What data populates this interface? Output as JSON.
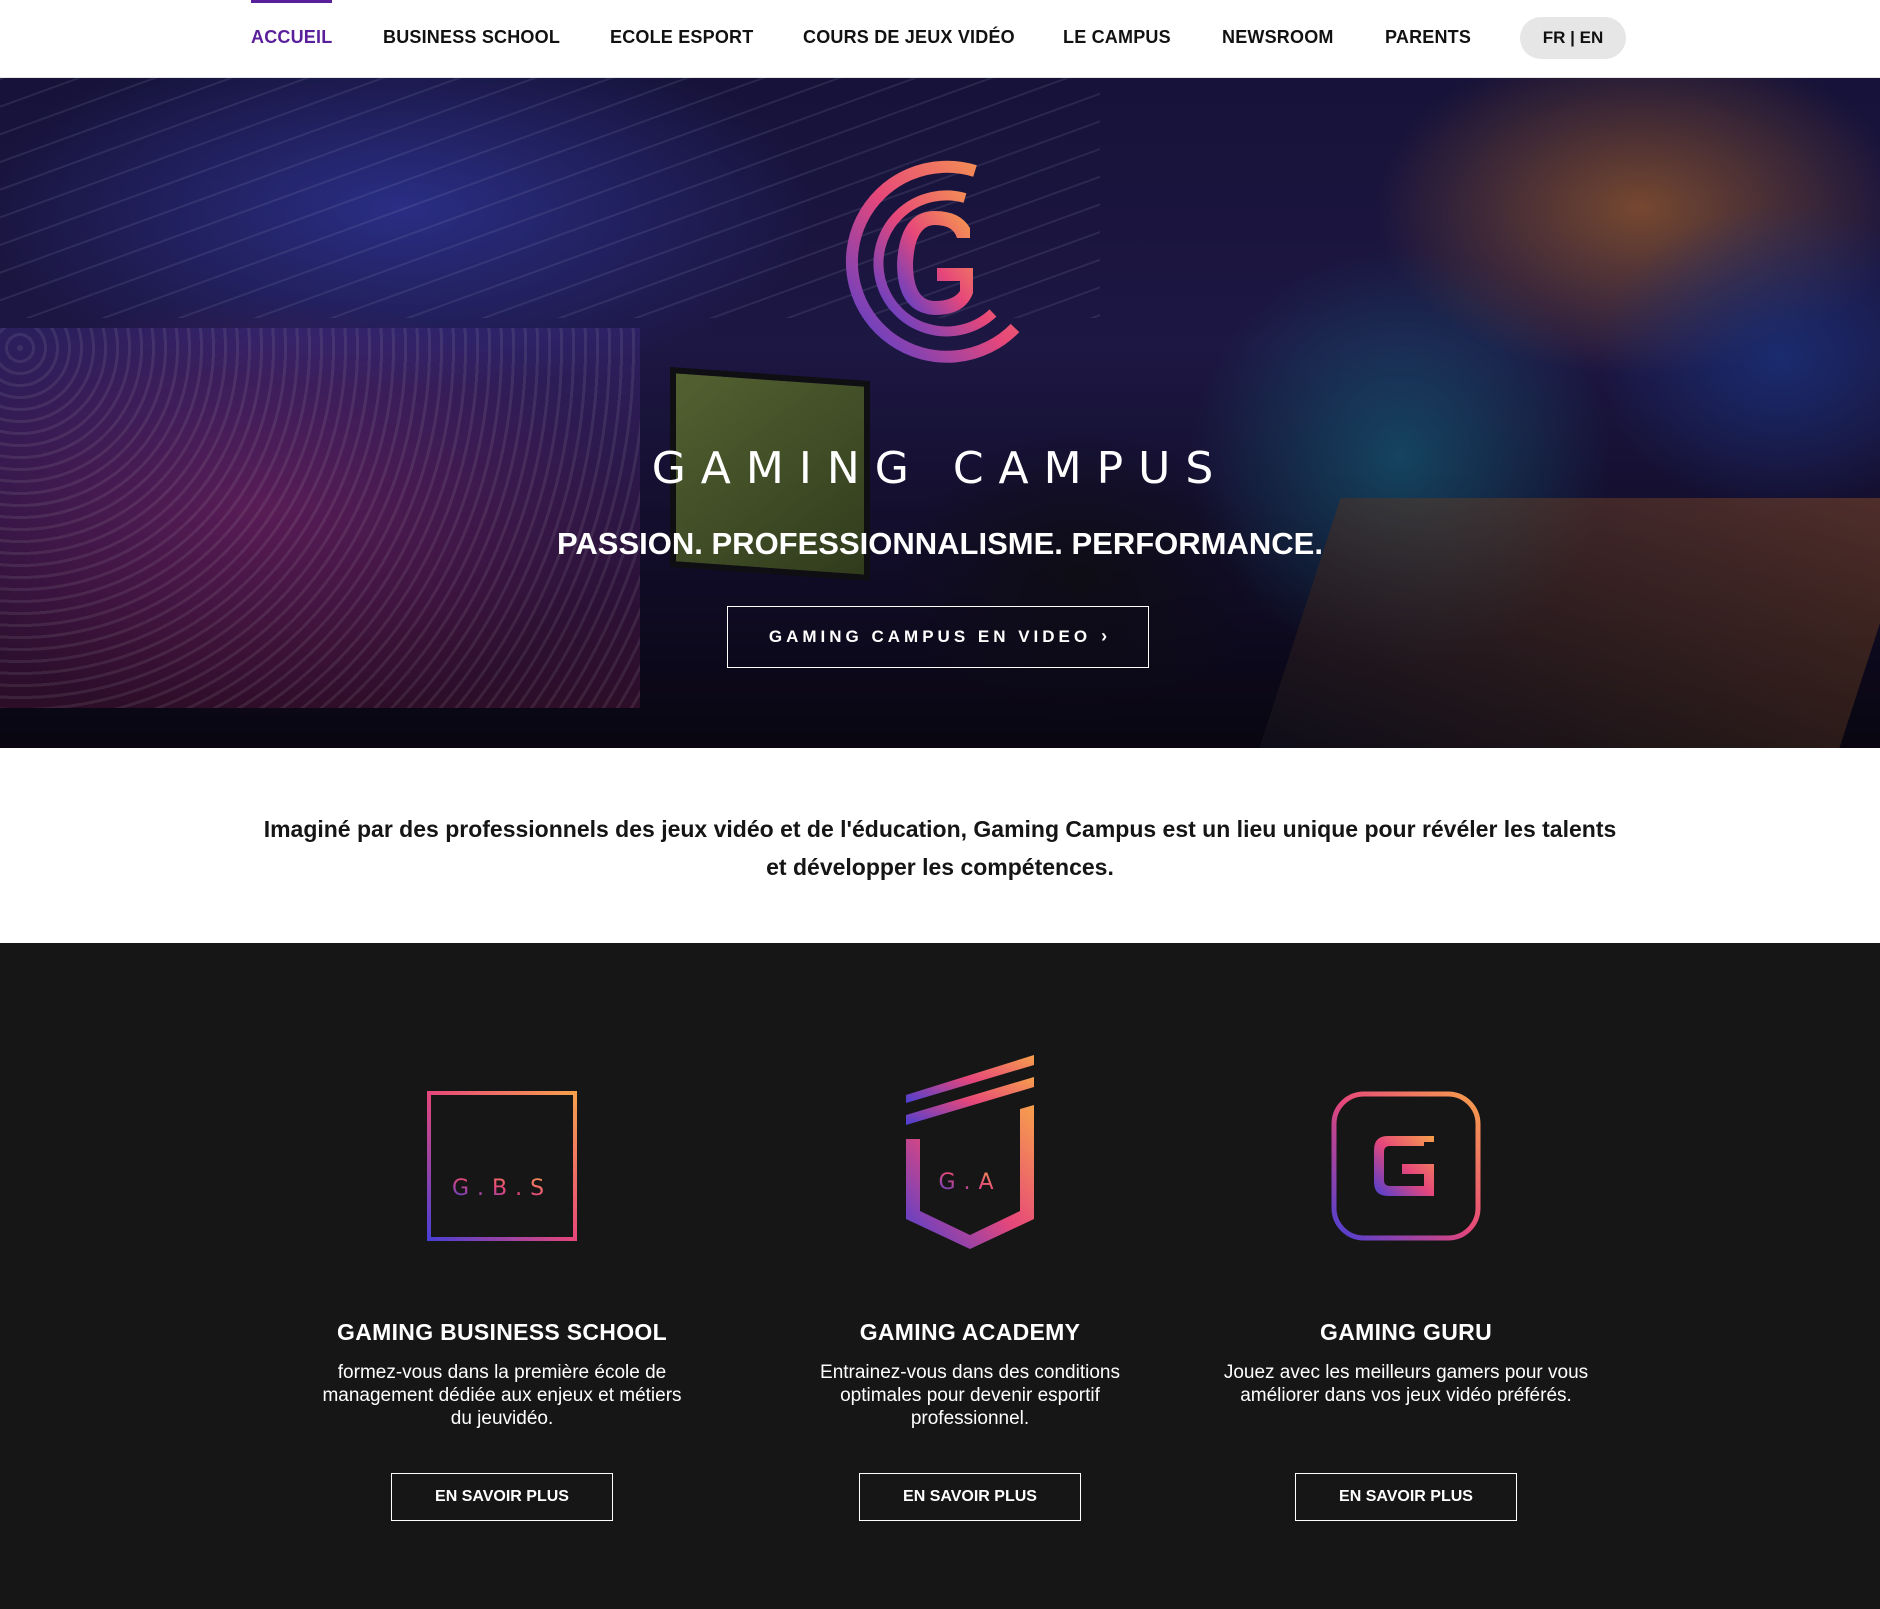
{
  "nav": {
    "items": [
      {
        "label": "ACCUEIL",
        "active": true
      },
      {
        "label": "BUSINESS SCHOOL",
        "active": false
      },
      {
        "label": "ECOLE ESPORT",
        "active": false
      },
      {
        "label": "COURS DE JEUX VIDÉO",
        "active": false
      },
      {
        "label": "LE CAMPUS",
        "active": false
      },
      {
        "label": "NEWSROOM",
        "active": false
      },
      {
        "label": "PARENTS",
        "active": false
      }
    ],
    "language": "FR | EN"
  },
  "hero": {
    "brand": "GAMING CAMPUS",
    "tagline": "PASSION. PROFESSIONNALISME. PERFORMANCE.",
    "video_button": "GAMING CAMPUS EN VIDEO",
    "video_button_icon": "chevron-right-icon"
  },
  "intro": {
    "text": "Imaginé par des professionnels des jeux vidéo et de l'éducation, Gaming Campus est un lieu unique pour révéler les talents et développer les compétences."
  },
  "programs": [
    {
      "logo_text": "G.B.S",
      "title": "GAMING BUSINESS SCHOOL",
      "description": "formez-vous dans la première école de management dédiée aux enjeux et métiers du jeuvidéo.",
      "button": "EN SAVOIR PLUS"
    },
    {
      "logo_text": "G.A",
      "title": "GAMING ACADEMY",
      "description": "Entrainez-vous dans des conditions optimales pour devenir esportif professionnel.",
      "button": "EN SAVOIR PLUS"
    },
    {
      "logo_text": "",
      "title": "GAMING GURU",
      "description": "Jouez avec les meilleurs gamers pour vous améliorer dans vos jeux vidéo préférés.",
      "button": "EN SAVOIR PLUS"
    }
  ],
  "colors": {
    "accent_purple": "#5a1f9a",
    "gradient_orange": "#f7a04b",
    "gradient_pink": "#e6477a",
    "gradient_blue": "#4a3fd4",
    "dark_section": "#161616"
  }
}
